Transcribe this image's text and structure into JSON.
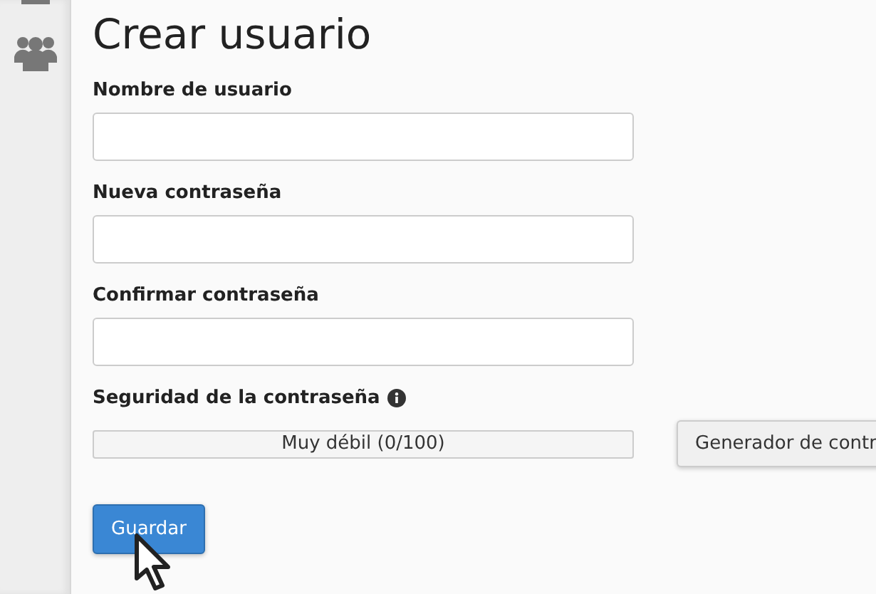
{
  "title": "Crear usuario",
  "fields": [
    {
      "label": "Nombre de usuario"
    },
    {
      "label": "Nueva contraseña"
    },
    {
      "label": "Confirmar contraseña"
    }
  ],
  "strength": {
    "label": "Seguridad de la contraseña",
    "level": 0,
    "reading": "Muy débil (0/100)"
  },
  "generator_button": "Generador de contr",
  "save_button": "Guardar"
}
